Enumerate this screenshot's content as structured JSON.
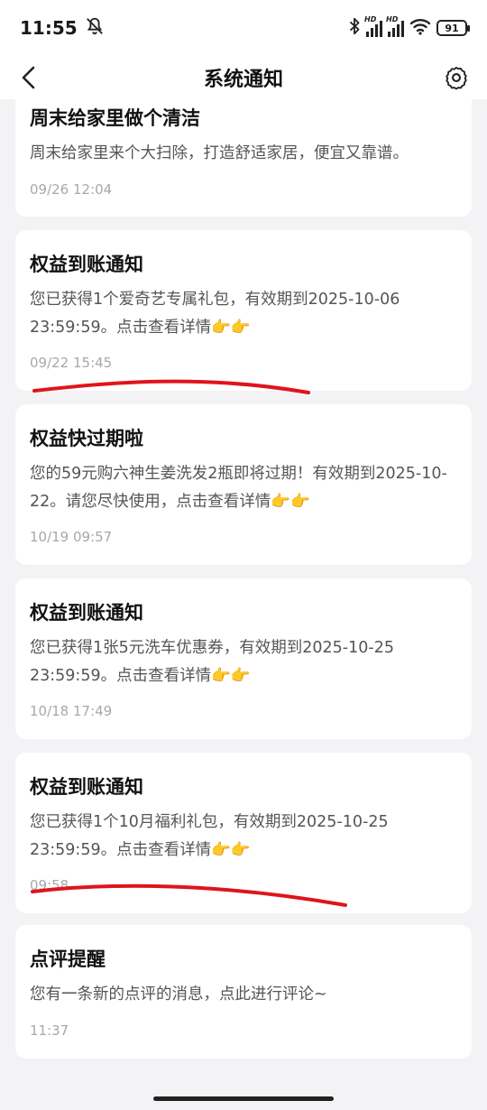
{
  "status_bar": {
    "time": "11:55",
    "signal_1_label": "HD",
    "signal_2_label": "HD",
    "battery": "91",
    "icons": [
      "mute-bell-icon",
      "bluetooth-icon",
      "signal-icon",
      "signal-icon",
      "wifi-icon",
      "battery-icon"
    ]
  },
  "nav": {
    "title": "系统通知",
    "back_icon": "chevron-left-icon",
    "settings_icon": "gear-icon"
  },
  "notifications": [
    {
      "title": "周末给家里做个清洁",
      "body": "周末给家里来个大扫除，打造舒适家居，便宜又靠谱。",
      "time": "09/26 12:04"
    },
    {
      "title": "权益到账通知",
      "body": "您已获得1个爱奇艺专属礼包，有效期到2025-10-06 23:59:59。点击查看详情👉👉",
      "time": "09/22 15:45"
    },
    {
      "title": "权益快过期啦",
      "body": "您的59元购六神生姜洗发2瓶即将过期！有效期到2025-10-22。请您尽快使用，点击查看详情👉👉",
      "time": "10/19 09:57"
    },
    {
      "title": "权益到账通知",
      "body": "您已获得1张5元洗车优惠券，有效期到2025-10-25 23:59:59。点击查看详情👉👉",
      "time": "10/18 17:49"
    },
    {
      "title": "权益到账通知",
      "body": "您已获得1个10月福利礼包，有效期到2025-10-25 23:59:59。点击查看详情👉👉",
      "time": "09:58"
    },
    {
      "title": "点评提醒",
      "body": "您有一条新的点评的消息，点此进行评论~",
      "time": "11:37"
    }
  ],
  "colors": {
    "background": "#f3f3f5",
    "card": "#ffffff",
    "annotation_stroke": "#e0141b"
  }
}
